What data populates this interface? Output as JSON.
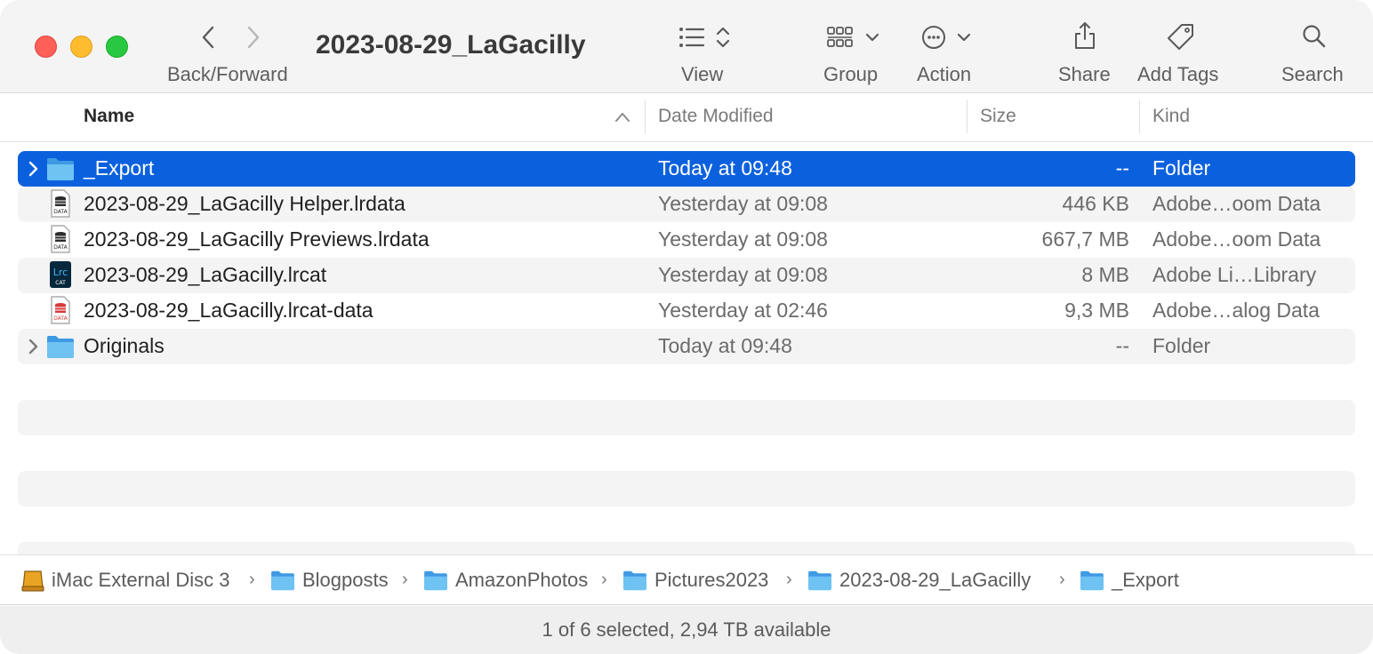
{
  "window": {
    "title": "2023-08-29_LaGacilly"
  },
  "toolbar": {
    "back_forward_label": "Back/Forward",
    "view_label": "View",
    "group_label": "Group",
    "action_label": "Action",
    "share_label": "Share",
    "add_tags_label": "Add Tags",
    "search_label": "Search"
  },
  "columns": {
    "name": "Name",
    "date_modified": "Date Modified",
    "size": "Size",
    "kind": "Kind",
    "sort_column": "Name",
    "sort_direction": "ascending"
  },
  "files": [
    {
      "name": "_Export",
      "date": "Today at 09:48",
      "size": "--",
      "kind": "Folder",
      "icon": "folder-icon",
      "expandable": true,
      "selected": true
    },
    {
      "name": "2023-08-29_LaGacilly Helper.lrdata",
      "date": "Yesterday at 09:08",
      "size": "446 KB",
      "kind": "Adobe…oom Data",
      "icon": "lrdata-file-icon",
      "expandable": false,
      "selected": false
    },
    {
      "name": "2023-08-29_LaGacilly Previews.lrdata",
      "date": "Yesterday at 09:08",
      "size": "667,7 MB",
      "kind": "Adobe…oom Data",
      "icon": "lrdata-file-icon",
      "expandable": false,
      "selected": false
    },
    {
      "name": "2023-08-29_LaGacilly.lrcat",
      "date": "Yesterday at 09:08",
      "size": "8 MB",
      "kind": "Adobe Li…Library",
      "icon": "lrcat-file-icon",
      "expandable": false,
      "selected": false
    },
    {
      "name": "2023-08-29_LaGacilly.lrcat-data",
      "date": "Yesterday at 02:46",
      "size": "9,3 MB",
      "kind": "Adobe…alog Data",
      "icon": "lrcat-data-file-icon",
      "expandable": false,
      "selected": false
    },
    {
      "name": "Originals",
      "date": "Today at 09:48",
      "size": "--",
      "kind": "Folder",
      "icon": "folder-icon",
      "expandable": true,
      "selected": false
    }
  ],
  "pathbar": [
    {
      "label": "iMac External Disc 3",
      "icon": "external-disk-icon"
    },
    {
      "label": "Blogposts",
      "icon": "folder-icon"
    },
    {
      "label": "AmazonPhotos",
      "icon": "folder-icon"
    },
    {
      "label": "Pictures2023",
      "icon": "folder-icon"
    },
    {
      "label": "2023-08-29_LaGacilly",
      "icon": "folder-icon"
    },
    {
      "label": "_Export",
      "icon": "folder-icon"
    }
  ],
  "pathbar_separator": "›",
  "status": {
    "text": "1 of 6 selected, 2,94 TB available"
  },
  "colors": {
    "selection": "#0b61dd",
    "folder": "#5ab4ef",
    "traffic_red": "#fe5f57",
    "traffic_yellow": "#febc2e",
    "traffic_green": "#28c840"
  }
}
